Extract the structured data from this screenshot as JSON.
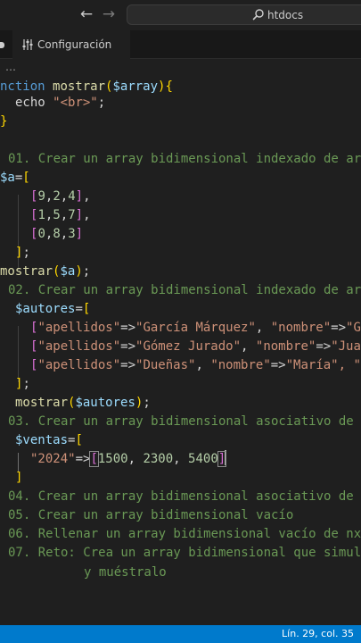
{
  "titlebar": {
    "back_icon": "←",
    "forward_icon": "→",
    "search_text": "htdocs"
  },
  "tab": {
    "label": "Configuración"
  },
  "breadcrumb": "…",
  "code": {
    "l1": {
      "kw": "nction",
      "name": "mostrar",
      "open": "(",
      "param": "$array",
      "close": ")",
      "brace": "{"
    },
    "l2": {
      "kw": "echo",
      "str": "\"<br>\"",
      "semi": ";"
    },
    "l3": {
      "brace": "}"
    },
    "l4": {
      "comment": "01. Crear un array bidimensional indexado de ar"
    },
    "l5": {
      "var": "$a",
      "eq": "=",
      "open": "["
    },
    "l6": {
      "open": "[",
      "a": "9",
      "b": "2",
      "c": "4",
      "close": "]",
      "comma": ","
    },
    "l7": {
      "open": "[",
      "a": "1",
      "b": "5",
      "c": "7",
      "close": "]",
      "comma": ","
    },
    "l8": {
      "open": "[",
      "a": "0",
      "b": "8",
      "c": "3",
      "close": "]"
    },
    "l9": {
      "close": "]",
      "semi": ";"
    },
    "l10": {
      "name": "mostrar",
      "open": "(",
      "arg": "$a",
      "close": ")",
      "semi": ";"
    },
    "l11": {
      "comment": "02. Crear un array bidimensional indexado de ar"
    },
    "l12": {
      "var": "$autores",
      "eq": "=",
      "open": "["
    },
    "l13": {
      "open": "[",
      "k1": "\"apellidos\"",
      "arrow1": "=>",
      "v1": "\"García Márquez\"",
      "sep": ", ",
      "k2": "\"nombre\"",
      "arrow2": "=>",
      "v2": "\"G"
    },
    "l14": {
      "open": "[",
      "k1": "\"apellidos\"",
      "arrow1": "=>",
      "v1": "\"Gómez Jurado\"",
      "sep": ", ",
      "k2": "\"nombre\"",
      "arrow2": "=>",
      "v2": "\"Jua"
    },
    "l15": {
      "open": "[",
      "k1": "\"apellidos\"",
      "arrow1": "=>",
      "v1": "\"Dueñas\"",
      "sep": ", ",
      "k2": "\"nombre\"",
      "arrow2": "=>",
      "v2": "\"María\"",
      "tail": ", \""
    },
    "l16": {
      "close": "]",
      "semi": ";"
    },
    "l17": {
      "name": "mostrar",
      "open": "(",
      "arg": "$autores",
      "close": ")",
      "semi": ";"
    },
    "l18": {
      "comment": "03. Crear un array bidimensional asociativo de"
    },
    "l19": {
      "var": "$ventas",
      "eq": "=",
      "open": "["
    },
    "l20": {
      "key": "\"2024\"",
      "arrow": "=>",
      "open": "[",
      "a": "1500",
      "b": "2300",
      "c": "5400",
      "close": "]"
    },
    "l21": {
      "close": "]"
    },
    "l22": {
      "comment": "04. Crear un array bidimensional asociativo de"
    },
    "l23": {
      "comment": "05. Crear un array bidimensional vacío"
    },
    "l24": {
      "comment": "06. Rellenar un array bidimensional vacío de nx"
    },
    "l25": {
      "comment": "07. Reto: Crea un array bidimensional que simul"
    },
    "l26": {
      "comment": "y muéstralo"
    }
  },
  "statusbar": {
    "position": "Lín. 29, col. 35"
  },
  "colors": {
    "background": "#1f1f1f",
    "keyword": "#569cd6",
    "function": "#dcdcaa",
    "variable": "#9cdcfe",
    "string": "#ce9178",
    "number": "#b5cea8",
    "comment": "#6a9955",
    "status_bar": "#007acc"
  }
}
